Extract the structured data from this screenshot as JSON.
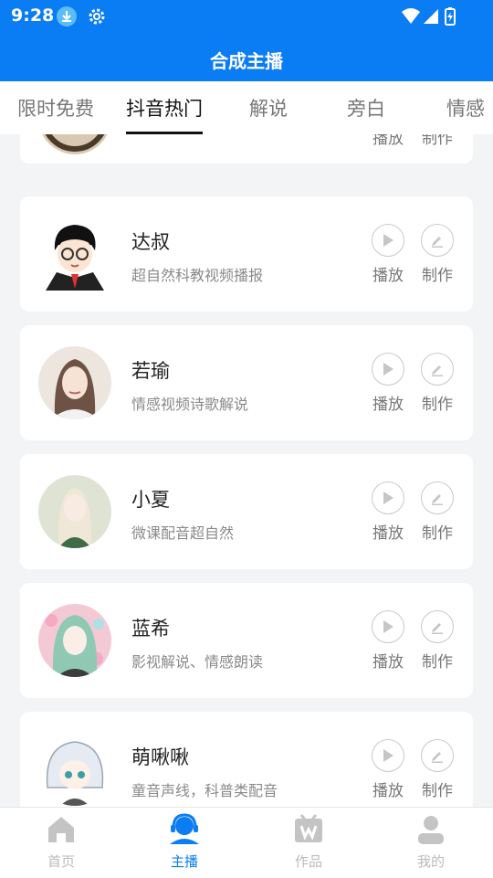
{
  "status_bar": {
    "time": "9:28"
  },
  "header": {
    "title": "合成主播"
  },
  "tabs": [
    {
      "label": "限时免费"
    },
    {
      "label": "抖音热门",
      "active": true
    },
    {
      "label": "解说"
    },
    {
      "label": "旁白"
    },
    {
      "label": "情感"
    }
  ],
  "partial_card": {
    "play_label": "播放",
    "make_label": "制作"
  },
  "anchors": [
    {
      "name": "达叔",
      "desc": "超自然科教视频播报",
      "play_label": "播放",
      "make_label": "制作"
    },
    {
      "name": "若瑜",
      "desc": "情感视频诗歌解说",
      "play_label": "播放",
      "make_label": "制作"
    },
    {
      "name": "小夏",
      "desc": "微课配音超自然",
      "play_label": "播放",
      "make_label": "制作"
    },
    {
      "name": "蓝希",
      "desc": "影视解说、情感朗读",
      "play_label": "播放",
      "make_label": "制作"
    },
    {
      "name": "萌啾啾",
      "desc": "童音声线，科普类配音",
      "play_label": "播放",
      "make_label": "制作"
    }
  ],
  "bottom_nav": [
    {
      "label": "首页",
      "icon": "home-icon"
    },
    {
      "label": "主播",
      "icon": "anchor-icon",
      "active": true
    },
    {
      "label": "作品",
      "icon": "works-icon"
    },
    {
      "label": "我的",
      "icon": "profile-icon"
    }
  ],
  "colors": {
    "primary": "#0a7cf4",
    "background": "#f3f4f6",
    "inactive": "#bbbbbb"
  }
}
